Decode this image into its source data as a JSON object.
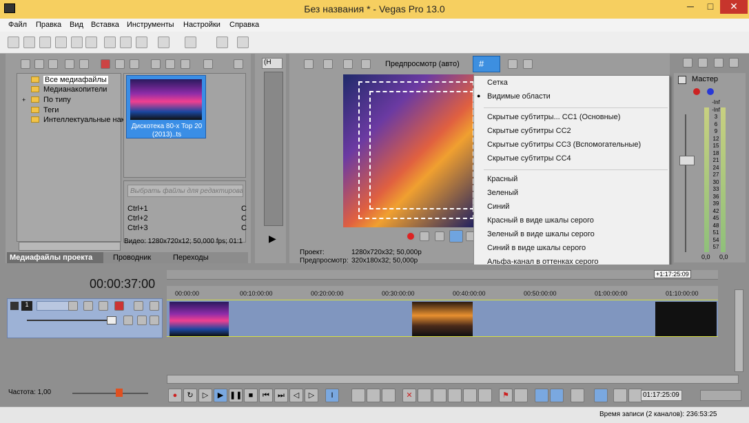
{
  "window": {
    "title": "Без названия * - Vegas Pro 13.0",
    "min": "─",
    "max": "□",
    "close": "✕"
  },
  "menu": [
    "Файл",
    "Правка",
    "Вид",
    "Вставка",
    "Инструменты",
    "Настройки",
    "Справка"
  ],
  "explorer": {
    "tree": [
      "Все медиафайлы",
      "Медианакопители",
      "По типу",
      "Теги",
      "Интеллектуальные нак"
    ],
    "expand": "+",
    "thumb_label_1": "Дискотека 80-х Top 20",
    "thumb_label_2": "(2013)..ts",
    "search_placeholder": "Выбрать файлы для редактирован",
    "shortcuts": [
      "Ctrl+1",
      "Ctrl+2",
      "Ctrl+3"
    ],
    "shortcut_vals": [
      "C",
      "C",
      "C"
    ],
    "video_info": "Видео: 1280x720x12; 50,000 fps; 01:1"
  },
  "tabs": [
    "Медиафайлы проекта",
    "Проводник",
    "Переходы"
  ],
  "trimmer": {
    "dropdown": "(Н"
  },
  "preview": {
    "mode": "Предпросмотр (авто)",
    "project_label": "Проект:",
    "project_value": "1280x720x32; 50,000p",
    "preview_label": "Предпросмотр:",
    "preview_value": "320x180x32; 50,000p"
  },
  "overlay_menu": {
    "items": [
      {
        "label": "Сетка",
        "checked": false
      },
      {
        "label": "Видимые области",
        "checked": true
      },
      {
        "label": "Скрытые субтитры... CC1 (Основные)",
        "checked": false
      },
      {
        "label": "Скрытые субтитры CC2",
        "checked": false
      },
      {
        "label": "Скрытые субтитры CC3 (Вспомогательные)",
        "checked": false
      },
      {
        "label": "Скрытые субтитры CC4",
        "checked": false
      },
      {
        "label": "Красный",
        "checked": false
      },
      {
        "label": "Зеленый",
        "checked": false
      },
      {
        "label": "Синий",
        "checked": false
      },
      {
        "label": "Красный в виде шкалы серого",
        "checked": false
      },
      {
        "label": "Зеленый в виде шкалы серого",
        "checked": false
      },
      {
        "label": "Синий в виде шкалы серого",
        "checked": false
      },
      {
        "label": "Альфа-канал в оттенках серого",
        "checked": false
      }
    ]
  },
  "mixer": {
    "title": "Мастер",
    "scale": [
      "-Inf",
      "-Inf",
      "3",
      "6",
      "9",
      "12",
      "15",
      "18",
      "21",
      "24",
      "27",
      "30",
      "33",
      "36",
      "39",
      "42",
      "45",
      "48",
      "51",
      "54",
      "57"
    ],
    "val_left": "0,0",
    "val_right": "0,0"
  },
  "timeline": {
    "timecode": "00:00:37:00",
    "end_marker": "+1:17:25:09",
    "ruler": [
      "00:00:00",
      "00:10:00:00",
      "00:20:00:00",
      "00:30:00:00",
      "00:40:00:00",
      "00:50:00:00",
      "01:00:00:00",
      "01:10:00:00"
    ],
    "track_number": "1"
  },
  "transport": {
    "rate": "Частота: 1,00",
    "time": "01:17:25:09"
  },
  "status": {
    "text": "Время записи (2 каналов): 236:53:25"
  }
}
